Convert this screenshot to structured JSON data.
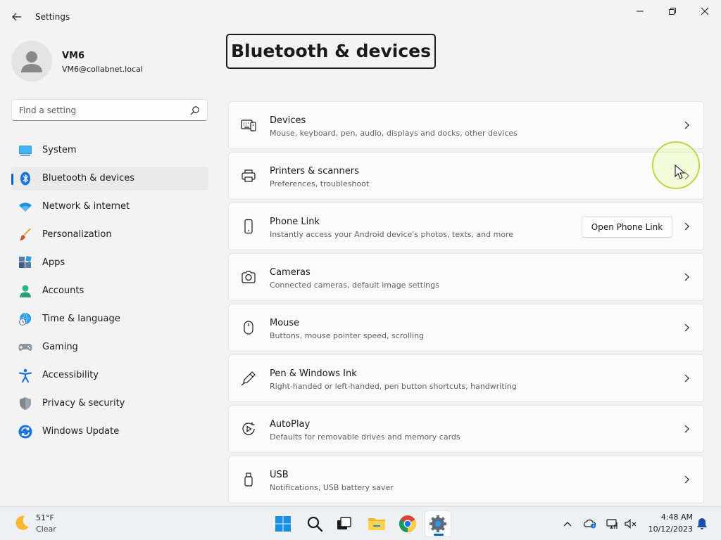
{
  "window": {
    "title": "Settings",
    "controls": {
      "minimize": "minimize",
      "maximize": "maximize",
      "close": "close"
    }
  },
  "profile": {
    "name": "VM6",
    "email": "VM6@collabnet.local"
  },
  "search": {
    "placeholder": "Find a setting"
  },
  "sidebar": {
    "items": [
      {
        "label": "System",
        "icon": "system-icon"
      },
      {
        "label": "Bluetooth & devices",
        "icon": "bluetooth-icon",
        "active": true
      },
      {
        "label": "Network & internet",
        "icon": "wifi-icon"
      },
      {
        "label": "Personalization",
        "icon": "brush-icon"
      },
      {
        "label": "Apps",
        "icon": "apps-icon"
      },
      {
        "label": "Accounts",
        "icon": "accounts-icon"
      },
      {
        "label": "Time & language",
        "icon": "globe-clock-icon"
      },
      {
        "label": "Gaming",
        "icon": "gamepad-icon"
      },
      {
        "label": "Accessibility",
        "icon": "accessibility-icon"
      },
      {
        "label": "Privacy & security",
        "icon": "shield-icon"
      },
      {
        "label": "Windows Update",
        "icon": "update-icon"
      }
    ]
  },
  "main": {
    "title": "Bluetooth & devices",
    "cards": [
      {
        "title": "Devices",
        "desc": "Mouse, keyboard, pen, audio, displays and docks, other devices",
        "icon": "devices-icon"
      },
      {
        "title": "Printers & scanners",
        "desc": "Preferences, troubleshoot",
        "icon": "printer-icon"
      },
      {
        "title": "Phone Link",
        "desc": "Instantly access your Android device's photos, texts, and more",
        "icon": "phone-icon",
        "button": "Open Phone Link"
      },
      {
        "title": "Cameras",
        "desc": "Connected cameras, default image settings",
        "icon": "camera-icon"
      },
      {
        "title": "Mouse",
        "desc": "Buttons, mouse pointer speed, scrolling",
        "icon": "mouse-icon"
      },
      {
        "title": "Pen & Windows Ink",
        "desc": "Right-handed or left-handed, pen button shortcuts, handwriting",
        "icon": "pen-icon"
      },
      {
        "title": "AutoPlay",
        "desc": "Defaults for removable drives and memory cards",
        "icon": "autoplay-icon"
      },
      {
        "title": "USB",
        "desc": "Notifications, USB battery saver",
        "icon": "usb-icon"
      }
    ]
  },
  "taskbar": {
    "weather": {
      "temp": "51°F",
      "desc": "Clear",
      "icon": "moon-icon"
    },
    "apps": [
      {
        "name": "start",
        "icon": "windows-logo-icon"
      },
      {
        "name": "search",
        "icon": "search-icon"
      },
      {
        "name": "task-view",
        "icon": "task-view-icon"
      },
      {
        "name": "file-explorer",
        "icon": "folder-icon"
      },
      {
        "name": "chrome",
        "icon": "chrome-icon"
      },
      {
        "name": "settings",
        "icon": "settings-gear-icon",
        "active": true
      }
    ],
    "tray": [
      "chevron-up-icon",
      "onedrive-icon",
      "network-icon",
      "volume-muted-icon"
    ],
    "clock": {
      "time": "4:48 AM",
      "date": "10/12/2023"
    },
    "notification_icon": "bell-icon"
  },
  "colors": {
    "accent": "#0067c0",
    "background": "#f3f3f3",
    "card": "#fbfbfb"
  }
}
